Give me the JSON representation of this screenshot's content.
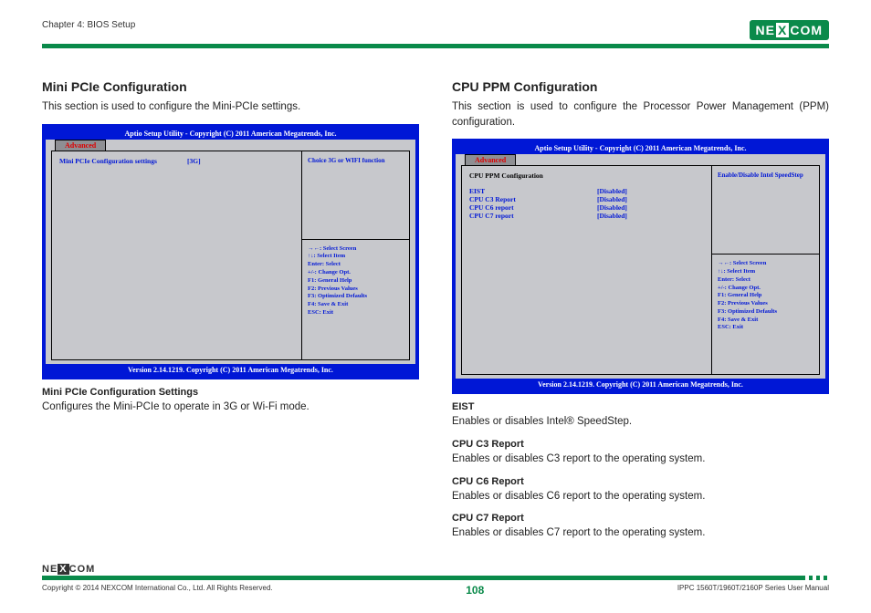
{
  "header": {
    "chapter": "Chapter 4: BIOS Setup",
    "logo_text_pre": "NE",
    "logo_text_x": "X",
    "logo_text_post": "COM"
  },
  "left": {
    "title": "Mini PCIe Configuration",
    "desc": "This section is used to configure the Mini-PCIe settings.",
    "bios": {
      "title": "Aptio Setup Utility - Copyright (C) 2011 American Megatrends, Inc.",
      "tab": "Advanced",
      "main_label": "Mini PCIe Configuration settings",
      "main_val": "[3G]",
      "hint": "Choice 3G or WIFI function",
      "keys": {
        "k1": "→←: Select Screen",
        "k2": "↑↓: Select Item",
        "k3": "Enter: Select",
        "k4": "+/-: Change Opt.",
        "k5": "F1: General Help",
        "k6": "F2: Previous Values",
        "k7": "F3: Optimized Defaults",
        "k8": "F4: Save & Exit",
        "k9": "ESC: Exit"
      },
      "footer": "Version 2.14.1219. Copyright (C) 2011 American Megatrends, Inc."
    },
    "sub": {
      "head": "Mini PCIe Configuration Settings",
      "desc": "Configures the Mini-PCIe to operate in 3G or Wi-Fi mode."
    }
  },
  "right": {
    "title": "CPU PPM Configuration",
    "desc": "This section is used to configure the Processor Power Management (PPM) configuration.",
    "bios": {
      "title": "Aptio Setup Utility - Copyright (C) 2011 American Megatrends, Inc.",
      "tab": "Advanced",
      "heading": "CPU PPM Configuration",
      "rows": [
        {
          "label": "EIST",
          "val": "[Disabled]"
        },
        {
          "label": "CPU C3 Report",
          "val": "[Disabled]"
        },
        {
          "label": "CPU C6 report",
          "val": "[Disabled]"
        },
        {
          "label": "CPU C7 report",
          "val": "[Disabled]"
        }
      ],
      "hint": "Enable/Disable Intel SpeedStep",
      "keys": {
        "k1": "→←: Select Screen",
        "k2": "↑↓: Select Item",
        "k3": "Enter: Select",
        "k4": "+/-: Change Opt.",
        "k5": "F1: General Help",
        "k6": "F2: Previous Values",
        "k7": "F3: Optimized Defaults",
        "k8": "F4: Save & Exit",
        "k9": "ESC: Exit"
      },
      "footer": "Version 2.14.1219. Copyright (C) 2011 American Megatrends, Inc."
    },
    "items": [
      {
        "head": "EIST",
        "desc": "Enables or disables Intel® SpeedStep."
      },
      {
        "head": "CPU C3 Report",
        "desc": "Enables or disables C3 report to the operating system."
      },
      {
        "head": "CPU C6 Report",
        "desc": "Enables or disables C6 report to the operating system."
      },
      {
        "head": "CPU C7 Report",
        "desc": "Enables or disables C7 report to the operating system."
      }
    ]
  },
  "footer": {
    "copyright": "Copyright © 2014 NEXCOM International Co., Ltd. All Rights Reserved.",
    "page": "108",
    "manual": "IPPC 1560T/1960T/2160P Series User Manual"
  }
}
